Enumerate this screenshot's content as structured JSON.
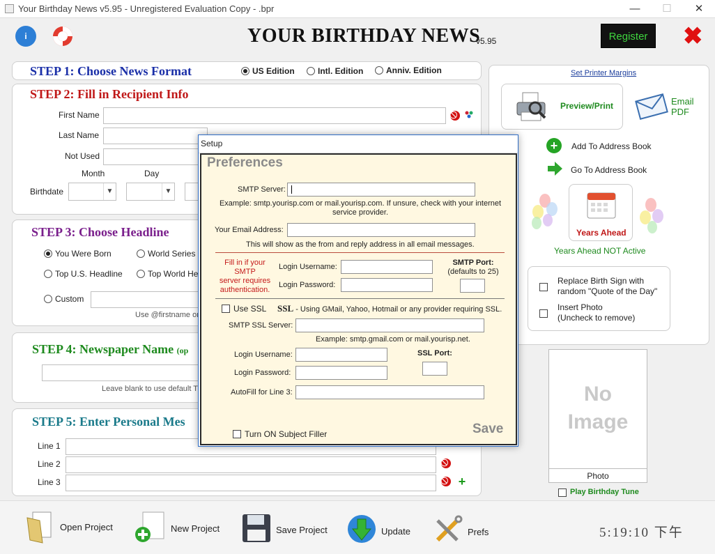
{
  "window": {
    "title": "Your Birthday News v5.95 - Unregistered Evaluation Copy - .bpr",
    "minimize": "—",
    "maximize": "☐",
    "close": "✕"
  },
  "header": {
    "brand": "YOUR BIRTHDAY NEWS",
    "version": "v5.95",
    "register_label": "Register",
    "close_glyph": "✖"
  },
  "step1": {
    "title": "STEP 1: Choose News Format",
    "options": [
      "US Edition",
      "Intl. Edition",
      "Anniv. Edition"
    ],
    "selected": "US Edition"
  },
  "step2": {
    "title": "STEP 2: Fill in Recipient Info",
    "first_name_label": "First Name",
    "last_name_label": "Last Name",
    "not_used_label": "Not Used",
    "month_label": "Month",
    "day_label": "Day",
    "birthdate_label": "Birthdate"
  },
  "step3": {
    "title": "STEP 3: Choose Headline",
    "options": [
      "You Were Born",
      "World Series",
      "Top U.S. Headline",
      "Top World He"
    ],
    "custom_label": "Custom",
    "hint": "Use @firstname or"
  },
  "step4": {
    "title": "STEP 4: Newspaper Name",
    "title_suffix": "(op",
    "hint": "Leave blank to use default T"
  },
  "step5": {
    "title": "STEP 5: Enter Personal Mes",
    "line_labels": [
      "Line 1",
      "Line 2",
      "Line 3"
    ]
  },
  "right": {
    "printer_margins": "Set Printer Margins",
    "preview_print": "Preview/Print",
    "email_pdf": [
      "Email",
      "PDF"
    ],
    "add_address": "Add To Address Book",
    "go_address": "Go To Address Book",
    "years_ahead": "Years Ahead",
    "years_status": "Years Ahead NOT Active",
    "replace_sign": [
      "Replace Birth Sign with",
      "random \"Quote of the Day\""
    ],
    "insert_photo": [
      "Insert Photo",
      "(Uncheck to remove)"
    ],
    "no_image": [
      "No",
      "Image"
    ],
    "photo_label": "Photo",
    "play_tune": "Play Birthday Tune"
  },
  "dialog": {
    "title": "Setup",
    "heading": "Preferences",
    "smtp_server_label": "SMTP Server:",
    "smtp_example": "Example: smtp.yourisp.com or mail.yourisp.com. If unsure, check with your internet service provider.",
    "email_label": "Your Email Address:",
    "email_note": "This will show as the from and reply address in all email messages.",
    "auth_note": [
      "Fill in if your",
      "SMTP",
      "server requires",
      "authentication."
    ],
    "login_user_label": "Login Username:",
    "login_pass_label": "Login Password:",
    "smtp_port_label": "SMTP Port:",
    "smtp_port_default": "(defaults to 25)",
    "use_ssl_label": "Use SSL",
    "ssl_bold": "SSL",
    "ssl_desc": "- Using GMail, Yahoo, Hotmail or any provider requiring SSL.",
    "ssl_server_label": "SMTP SSL Server:",
    "ssl_example": "Example: smtp.gmail.com or mail.yourisp.net.",
    "ssl_login_user_label": "Login Username:",
    "ssl_login_pass_label": "Login Password:",
    "ssl_port_label": "SSL Port:",
    "autofill_label": "AutoFill for Line 3:",
    "subject_filler_label": "Turn ON Subject Filler",
    "save_label": "Save"
  },
  "toolbar": {
    "open": "Open Project",
    "new": "New Project",
    "save": "Save Project",
    "update": "Update",
    "prefs": "Prefs",
    "clock": "5:19:10 下午"
  },
  "colors": {
    "step1": "#1a2fa8",
    "step2": "#c01818",
    "step3": "#7a1f8c",
    "step4": "#1e8a1e",
    "step5": "#1a7a8a",
    "register_text": "#3fd43f"
  }
}
